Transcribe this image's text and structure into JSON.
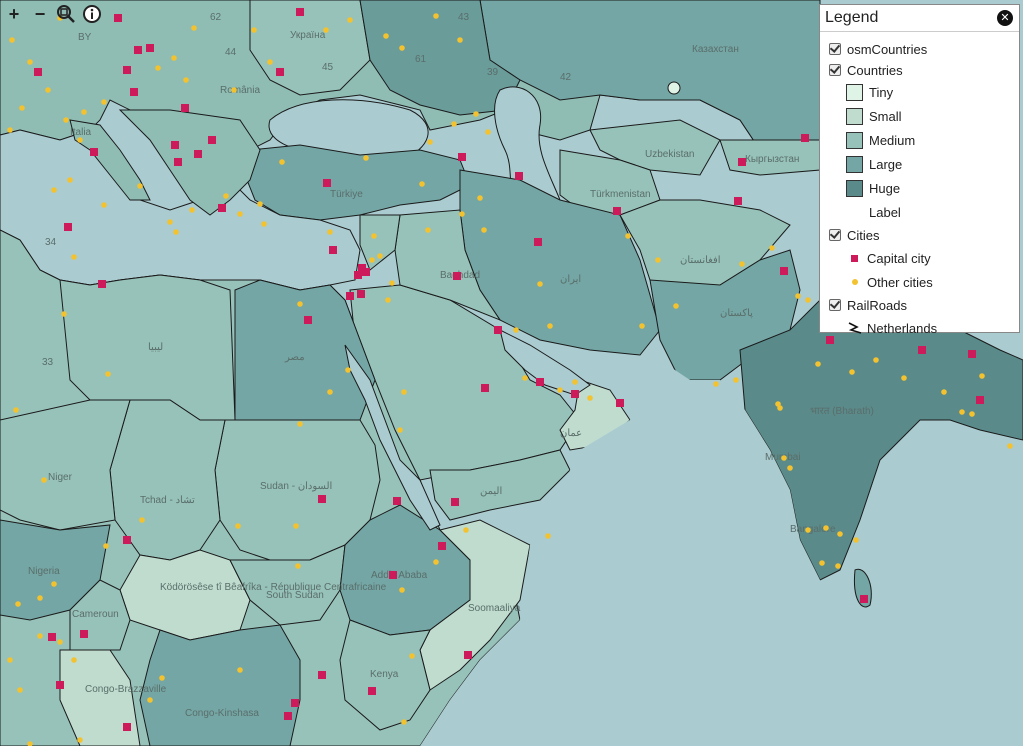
{
  "toolbar": {
    "zoom_in_label": "+",
    "zoom_out_label": "−",
    "icons": [
      "zoom-in-icon",
      "zoom-out-icon",
      "zoom-to-extent-icon",
      "info-icon"
    ]
  },
  "legend": {
    "title": "Legend",
    "layers": [
      {
        "label": "osmCountries",
        "checked": true
      },
      {
        "label": "Countries",
        "checked": true,
        "classes": [
          {
            "label": "Tiny",
            "color": "#dff3e6"
          },
          {
            "label": "Small",
            "color": "#bfdccf"
          },
          {
            "label": "Medium",
            "color": "#97c2b9"
          },
          {
            "label": "Large",
            "color": "#74a6a5"
          },
          {
            "label": "Huge",
            "color": "#5a8a8a"
          },
          {
            "label": "Label",
            "color": ""
          }
        ]
      },
      {
        "label": "Cities",
        "checked": true,
        "classes": [
          {
            "label": "Capital city",
            "color": "#cc1a5a"
          },
          {
            "label": "Other cities",
            "color": "#f2c230"
          }
        ]
      },
      {
        "label": "RailRoads",
        "checked": true,
        "classes": [
          {
            "label": "Netherlands",
            "color": "#111111"
          }
        ]
      }
    ]
  },
  "map_labels": {
    "ukraine": "Україна",
    "kazakhstan": "Казахстан",
    "romania": "România",
    "turkiye": "Türkiye",
    "uzbekistan": "Uzbekistan",
    "turkmenistan": "Türkmenistan",
    "kyrgyzstan": "Кыргызстан",
    "iran": "ایران",
    "afghanistan": "افغانستان",
    "pakistan": "پاکستان",
    "iraq": "Baghdad",
    "libya": "ليبيا",
    "egypt": "مصر",
    "sudan": "Sudan - السودان",
    "chad": "Tchad - تشاد",
    "niger": "Niger",
    "nigeria": "Nigeria",
    "cameroon": "Cameroun",
    "car": "Ködörösêse tî Bêafrîka - République Centrafricaine",
    "south_sudan": "South Sudan",
    "ethiopia": "Addis Ababa",
    "kenya": "Kenya",
    "somalia": "Soomaaliya",
    "congo": "Congo-Brazzaville",
    "drc": "Congo-Kinshasa",
    "india": "भारत (Bharath)",
    "yemen": "اليمن",
    "oman": "عمان",
    "mumbai": "Mumbai",
    "bangalore": "Bangalore",
    "italia": "Italia",
    "by": "BY",
    "sea_62": "62",
    "sea_61": "61",
    "sea_33": "33",
    "sea_34": "34",
    "sea_43": "43",
    "sea_44": "44",
    "sea_45": "45",
    "sea_39": "39",
    "sea_42": "42"
  },
  "colors": {
    "water": "#aacbd0",
    "capital": "#cc1a5a",
    "city": "#f2c230",
    "border": "#1a1a1a"
  }
}
